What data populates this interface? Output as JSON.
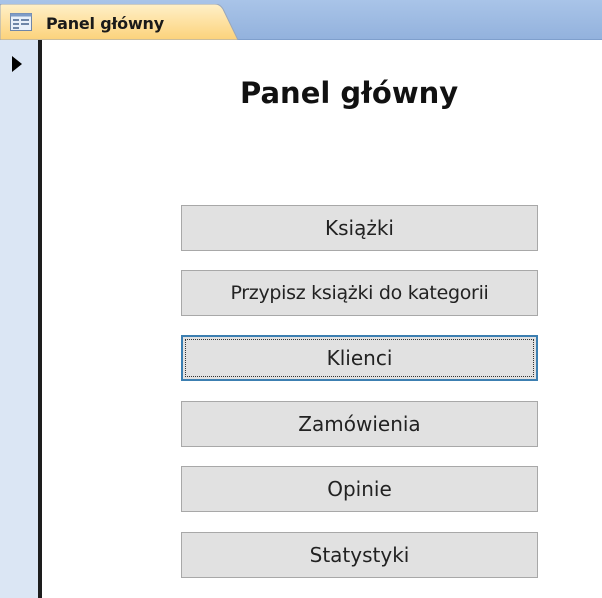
{
  "tab": {
    "label": "Panel główny"
  },
  "form": {
    "title": "Panel główny"
  },
  "buttons": [
    {
      "label": "Książki"
    },
    {
      "label": "Przypisz książki do kategorii"
    },
    {
      "label": "Klienci"
    },
    {
      "label": "Zamówienia"
    },
    {
      "label": "Opinie"
    },
    {
      "label": "Statystyki"
    }
  ],
  "focused_button": "Klienci",
  "colors": {
    "tab_active": "#fcd88f",
    "tab_strip": "#a9c4e8",
    "record_selector": "#dbe6f4",
    "button_face": "#e1e1e1",
    "focus_border": "#3c7fb1"
  },
  "icons": {
    "tab_icon": "form-icon",
    "record_marker": "current-record-arrow-icon"
  }
}
